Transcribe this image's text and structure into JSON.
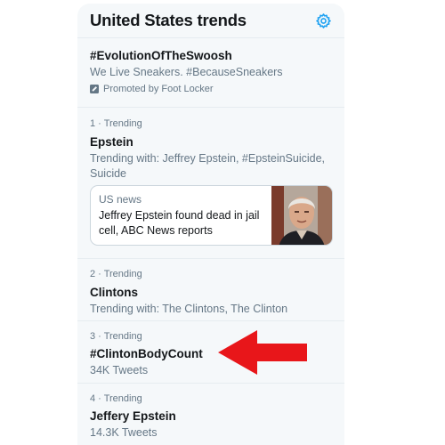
{
  "header": {
    "title": "United States trends",
    "settings_icon": "gear-icon",
    "accent": "#1da1f2"
  },
  "promoted_trend": {
    "name": "#EvolutionOfTheSwoosh",
    "description": "We Live Sneakers. #BecauseSneakers",
    "promoted_label": "Promoted by Foot Locker",
    "icon": "promoted-icon"
  },
  "trends": [
    {
      "meta": "1 · Trending",
      "name": "Epstein",
      "description": "Trending with: Jeffrey Epstein, #EpsteinSuicide, Suicide",
      "news": {
        "source": "US news",
        "headline": "Jeffrey Epstein found dead in jail cell, ABC News reports"
      }
    },
    {
      "meta": "2 · Trending",
      "name": "Clintons",
      "description": "Trending with: The Clintons, The Clinton"
    },
    {
      "meta": "3 · Trending",
      "name": "#ClintonBodyCount",
      "description": "34K Tweets"
    },
    {
      "meta": "4 · Trending",
      "name": "Jeffery Epstein",
      "description": "14.3K Tweets"
    }
  ],
  "annotation": {
    "arrow_color": "#e8161a"
  }
}
